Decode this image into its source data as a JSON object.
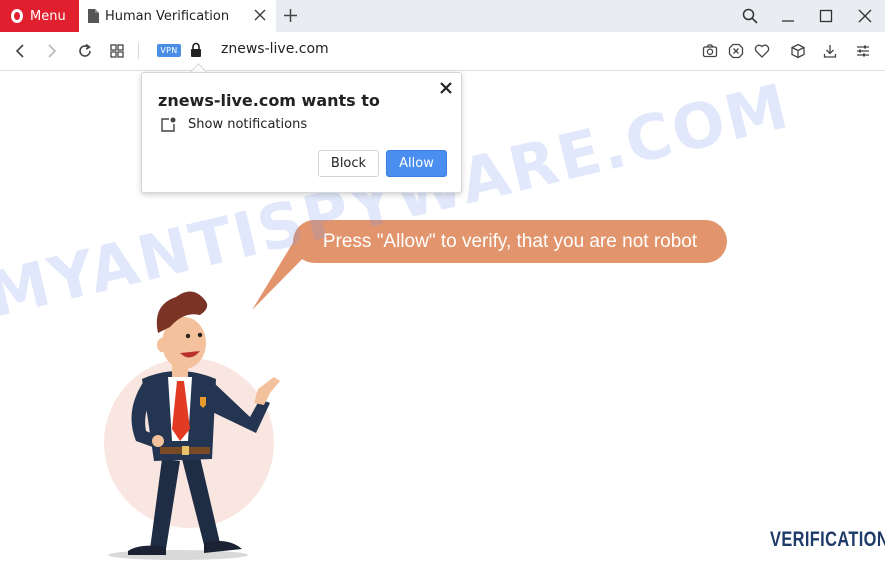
{
  "browser": {
    "menu_label": "Menu",
    "tab": {
      "title": "Human Verification"
    },
    "address": {
      "vpn_badge": "VPN",
      "url": "znews-live.com"
    }
  },
  "notification_popup": {
    "title": "znews-live.com wants to",
    "permission": "Show notifications",
    "block_label": "Block",
    "allow_label": "Allow"
  },
  "page": {
    "speech_text": "Press \"Allow\" to verify, that you are not robot",
    "logo_text": "VERIFICATION",
    "watermark": "MYANTISPYWARE.COM"
  },
  "colors": {
    "opera_red": "#e0202f",
    "accent_blue": "#4a8ff0",
    "bubble_orange": "#e2956c",
    "logo_navy": "#1e3a68"
  },
  "icons": {
    "tab_bar": [
      "opera-logo-icon",
      "document-icon",
      "close-icon",
      "plus-icon",
      "search-icon",
      "minimize-icon",
      "maximize-icon",
      "window-close-icon"
    ],
    "address_bar": [
      "back-icon",
      "forward-icon",
      "reload-icon",
      "speed-dial-icon",
      "lock-icon",
      "camera-icon",
      "ad-block-icon",
      "heart-icon",
      "cube-icon",
      "download-icon",
      "settings-sliders-icon"
    ]
  }
}
